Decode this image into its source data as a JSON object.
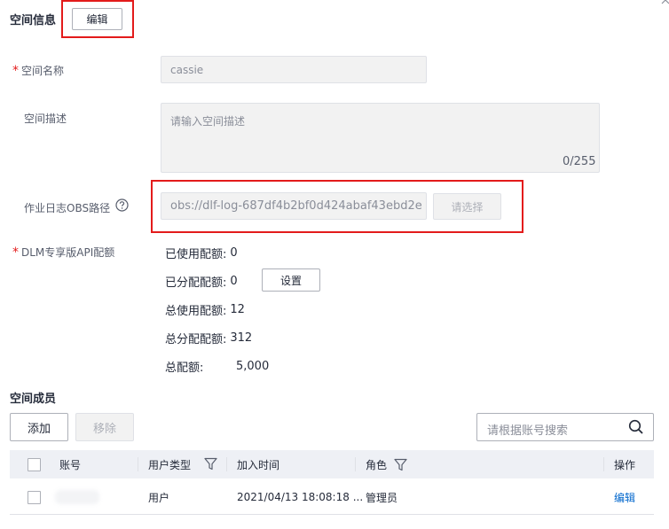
{
  "space_info": {
    "title": "空间信息",
    "edit_label": "编辑"
  },
  "form": {
    "name": {
      "label": "空间名称",
      "value": "cassie",
      "required": "*"
    },
    "desc": {
      "label": "空间描述",
      "placeholder": "请输入空间描述",
      "counter": "0/255"
    },
    "obs": {
      "label": "作业日志OBS路径",
      "value": "obs://dlf-log-687df4b2bf0d424abaf43ebd2e",
      "select_label": "请选择"
    },
    "quota": {
      "label": "DLM专享版API配额",
      "required": "*",
      "used_label": "已使用配额:",
      "used_value": "0",
      "allocated_label": "已分配配额:",
      "allocated_value": "0",
      "set_label": "设置",
      "total_used_label": "总使用配额:",
      "total_used_value": "12",
      "total_allocated_label": "总分配配额:",
      "total_allocated_value": "312",
      "total_label": "总配额:",
      "total_value": "5,000"
    }
  },
  "members": {
    "title": "空间成员",
    "add_label": "添加",
    "remove_label": "移除",
    "search_placeholder": "请根据账号搜索",
    "columns": {
      "account": "账号",
      "user_type": "用户类型",
      "join_time": "加入时间",
      "role": "角色",
      "action": "操作"
    },
    "rows": [
      {
        "account": "",
        "user_type": "用户",
        "join_time": "2021/04/13 18:08:18 ...",
        "role": "管理员",
        "action": "编辑"
      }
    ]
  },
  "colors": {
    "highlight": "#e31b1b",
    "link": "#0066cc",
    "header_bg": "#eef0f5"
  }
}
